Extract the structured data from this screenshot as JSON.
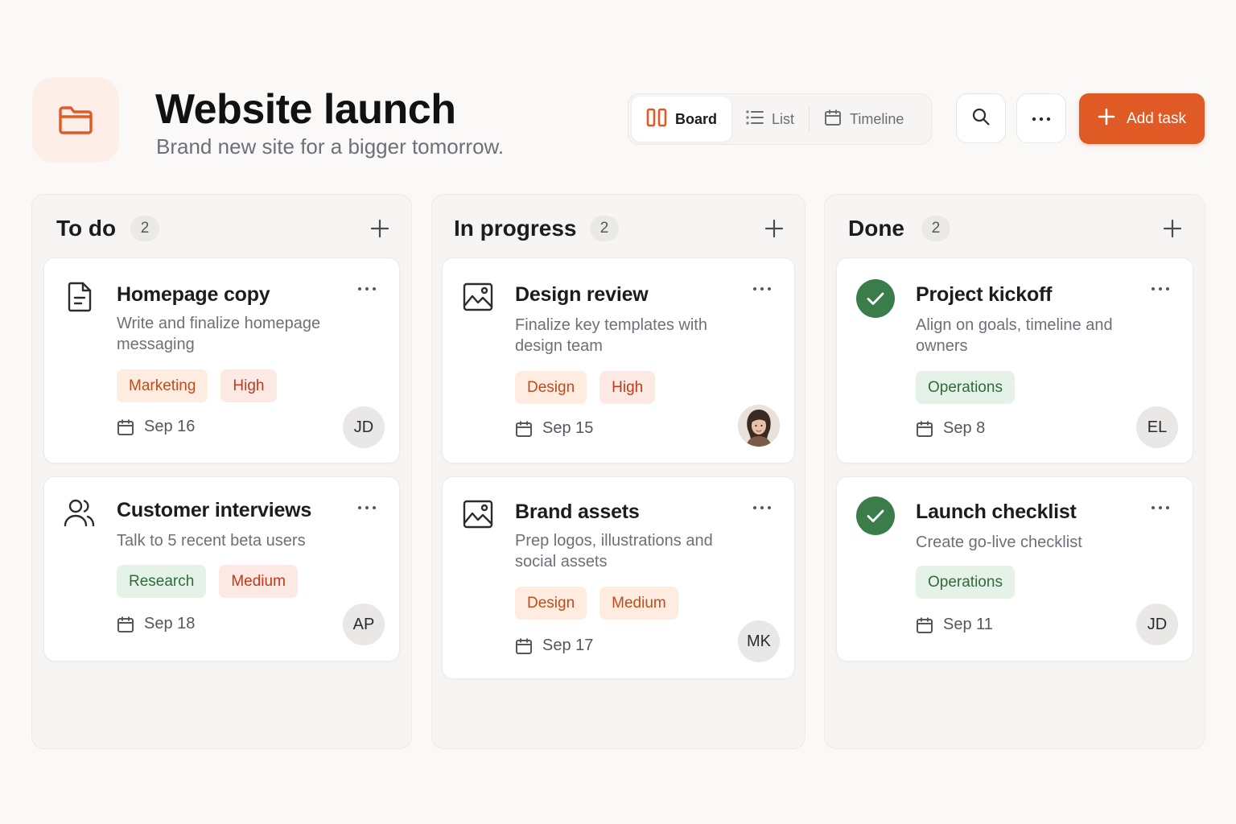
{
  "header": {
    "title": "Website launch",
    "subtitle": "Brand new site for a bigger tomorrow.",
    "project_icon": "folder-icon",
    "views": [
      {
        "label": "Board",
        "icon": "board-icon",
        "active": true
      },
      {
        "label": "List",
        "icon": "list-icon",
        "active": false
      },
      {
        "label": "Timeline",
        "icon": "calendar-icon",
        "active": false
      }
    ],
    "add_task_label": "Add task"
  },
  "colors": {
    "accent": "#df5a24",
    "done_check": "#3a7d4a",
    "tag_orange": "#c24b18",
    "tag_green": "#2f6b3c"
  },
  "columns": [
    {
      "title": "To do",
      "count": "2",
      "cards": [
        {
          "title": "Homepage copy",
          "description": "Write and finalize homepage messaging",
          "icon": "document-icon",
          "tags": [
            {
              "label": "Marketing",
              "tone": "orange"
            },
            {
              "label": "High",
              "tone": "red"
            }
          ],
          "due": "Sep 16",
          "assignee": "JD"
        },
        {
          "title": "Customer interviews",
          "description": "Talk to 5 recent beta users",
          "icon": "users-icon",
          "tags": [
            {
              "label": "Research",
              "tone": "green"
            },
            {
              "label": "Medium",
              "tone": "red"
            }
          ],
          "due": "Sep 18",
          "assignee": "AP"
        }
      ]
    },
    {
      "title": "In progress",
      "count": "2",
      "cards": [
        {
          "title": "Design review",
          "description": "Finalize key templates with design team",
          "icon": "image-icon",
          "tags": [
            {
              "label": "Design",
              "tone": "orange"
            },
            {
              "label": "High",
              "tone": "red"
            }
          ],
          "due": "Sep 15",
          "assignee": "photo"
        },
        {
          "title": "Brand assets",
          "description": "Prep logos, illustrations and social assets",
          "icon": "image-icon",
          "tags": [
            {
              "label": "Design",
              "tone": "orange"
            },
            {
              "label": "Medium",
              "tone": "orange"
            }
          ],
          "due": "Sep 17",
          "assignee": "MK"
        }
      ]
    },
    {
      "title": "Done",
      "count": "2",
      "cards": [
        {
          "title": "Project kickoff",
          "description": "Align on goals, timeline and owners",
          "icon": "check-circle-icon",
          "tags": [
            {
              "label": "Operations",
              "tone": "green"
            }
          ],
          "due": "Sep 8",
          "assignee": "EL"
        },
        {
          "title": "Launch checklist",
          "description": "Create go-live checklist",
          "icon": "check-circle-icon",
          "tags": [
            {
              "label": "Operations",
              "tone": "green"
            }
          ],
          "due": "Sep 11",
          "assignee": "JD"
        }
      ]
    }
  ]
}
